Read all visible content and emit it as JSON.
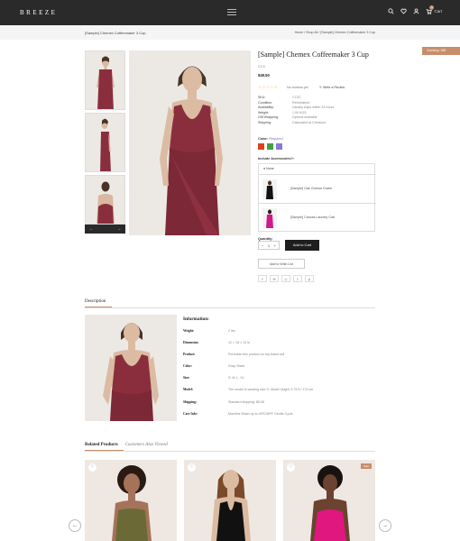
{
  "header": {
    "logo": "BREEZE",
    "cart_label": "Cart",
    "cart_count": "0"
  },
  "breadcrumb": {
    "left_title": "[Sample] Chemex Coffeemaker 3 Cup",
    "right": "Home  /  Shop All  /  [Sample] Chemex Coffeemaker 3 Cup"
  },
  "currency_button": "Currency: INR",
  "thumbnails_nav": {
    "prev": "←",
    "next": "→"
  },
  "product": {
    "title": "[Sample] Chemex Coffeemaker 3 Cup",
    "sku": "CC3",
    "price": "$49.50",
    "rating_stars": "☆☆☆☆☆",
    "no_reviews": "No reviews yet",
    "write_review": "Write a Review",
    "specs": [
      {
        "k": "SKU:",
        "v": "CC3C"
      },
      {
        "k": "Condition:",
        "v": "Refurbished"
      },
      {
        "k": "Availability:",
        "v": "Usually ships within 24 hours"
      },
      {
        "k": "Weight:",
        "v": "1.00 KGS"
      },
      {
        "k": "Gift Wrapping:",
        "v": "Options available"
      },
      {
        "k": "Shipping:",
        "v": "Calculated at Checkout"
      }
    ],
    "color_label": "Color:",
    "color_required": "Required",
    "swatch_colors": [
      "#d9421f",
      "#43a047",
      "#8a7ad6"
    ],
    "accessories_label": "Include Accessories?:",
    "accessories_none": "None",
    "accessories": [
      "[Sample] Oak Cheese Grater",
      "[Sample] Canvas Laundry Cart"
    ],
    "quantity_label": "Quantity:",
    "quantity_value": "1",
    "qty_minus": "−",
    "qty_plus": "+",
    "add_to_cart": "Add to Cart",
    "add_to_wishlist": "Add to Wish List",
    "share_icons": [
      "f",
      "✉",
      "⎙",
      "t",
      "p"
    ]
  },
  "description": {
    "tab_label": "Description",
    "info_title": "Information:",
    "rows": [
      {
        "k": "Weight:",
        "v": "2 lbs"
      },
      {
        "k": "Dimension:",
        "v": "12 × 15 × 13 in"
      },
      {
        "k": "Product:",
        "v": "Purchase this product on top brand sell"
      },
      {
        "k": "Color:",
        "v": "Gray, Black"
      },
      {
        "k": "Size:",
        "v": "S, M, L, XL"
      },
      {
        "k": "Model:",
        "v": "The model is wearing size S. Model height: 5.75 ft / 174 cm"
      },
      {
        "k": "Shipping:",
        "v": "Standard shipping: $5.95"
      },
      {
        "k": "Care Info:",
        "v": "Machine Wash up to 40ºC/86ºF Gentle Cycle"
      }
    ]
  },
  "related": {
    "tab_active": "Related Products",
    "tab_other": "Customers Also Viewed",
    "sale_badge": "Sale",
    "prev_arrow": "←",
    "next_arrow": "→"
  },
  "colors": {
    "accent": "#c78e6b",
    "dark": "#2a2a2a",
    "dress": "#8a2e3d"
  }
}
